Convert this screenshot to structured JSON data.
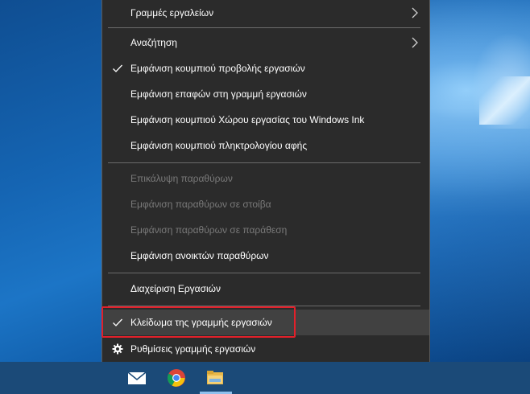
{
  "menu": {
    "items": [
      {
        "label": "Γραμμές εργαλείων",
        "submenu": true,
        "checked": false,
        "enabled": true,
        "icon": ""
      },
      {
        "label": "Αναζήτηση",
        "submenu": true,
        "checked": false,
        "enabled": true,
        "icon": ""
      },
      {
        "label": "Εμφάνιση κουμπιού προβολής εργασιών",
        "submenu": false,
        "checked": true,
        "enabled": true,
        "icon": "checkmark-icon"
      },
      {
        "label": "Εμφάνιση επαφών στη γραμμή εργασιών",
        "submenu": false,
        "checked": false,
        "enabled": true,
        "icon": ""
      },
      {
        "label": "Εμφάνιση κουμπιού Χώρου εργασίας του Windows Ink",
        "submenu": false,
        "checked": false,
        "enabled": true,
        "icon": ""
      },
      {
        "label": "Εμφάνιση κουμπιού πληκτρολογίου αφής",
        "submenu": false,
        "checked": false,
        "enabled": true,
        "icon": ""
      },
      {
        "label": "Επικάλυψη παραθύρων",
        "submenu": false,
        "checked": false,
        "enabled": false,
        "icon": ""
      },
      {
        "label": "Εμφάνιση παραθύρων σε στοίβα",
        "submenu": false,
        "checked": false,
        "enabled": false,
        "icon": ""
      },
      {
        "label": "Εμφάνιση παραθύρων σε παράθεση",
        "submenu": false,
        "checked": false,
        "enabled": false,
        "icon": ""
      },
      {
        "label": "Εμφάνιση ανοικτών παραθύρων",
        "submenu": false,
        "checked": false,
        "enabled": true,
        "icon": ""
      },
      {
        "label": "Διαχείριση Εργασιών",
        "submenu": false,
        "checked": false,
        "enabled": true,
        "icon": ""
      },
      {
        "label": "Κλείδωμα της γραμμής εργασιών",
        "submenu": false,
        "checked": true,
        "enabled": true,
        "hovered": true,
        "highlighted": true,
        "icon": "checkmark-icon"
      },
      {
        "label": "Ρυθμίσεις γραμμής εργασιών",
        "submenu": false,
        "checked": false,
        "enabled": true,
        "icon": "gear-icon"
      }
    ]
  },
  "taskbar": {
    "pinned": [
      "mail-icon",
      "chrome-icon",
      "file-explorer-icon"
    ],
    "active": "file-explorer-icon"
  },
  "colors": {
    "menu_bg": "#2b2b2b",
    "hover_bg": "#414141",
    "disabled_text": "#7a7a7a",
    "highlight_border": "#e2202a",
    "taskbar_bg": "#1b4a78"
  }
}
